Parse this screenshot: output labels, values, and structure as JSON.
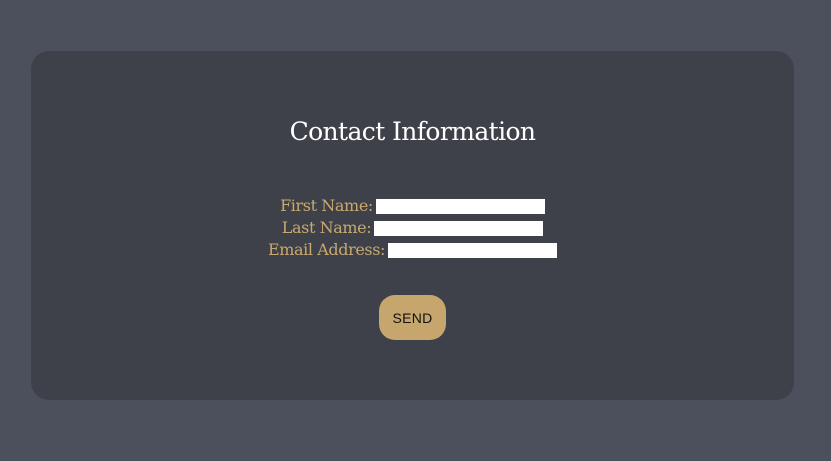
{
  "form": {
    "title": "Contact Information",
    "fields": [
      {
        "label": "First Name:",
        "value": "",
        "placeholder": ""
      },
      {
        "label": "Last Name:",
        "value": "",
        "placeholder": ""
      },
      {
        "label": "Email Address:",
        "value": "",
        "placeholder": ""
      }
    ],
    "send_label": "SEND"
  },
  "colors": {
    "page_background": "#4b505c",
    "card_background": "#3e414a",
    "title_text": "#ffffff",
    "label_text": "#c8a96e",
    "button_background": "#c6a66c",
    "field_background": "#ffffff"
  }
}
